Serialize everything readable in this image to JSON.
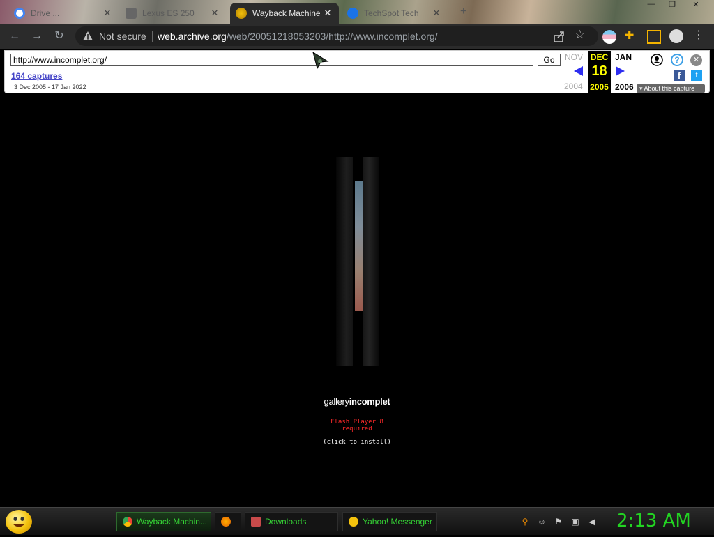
{
  "tabs": [
    {
      "title": "Drive ...",
      "favicon": "google-icon"
    },
    {
      "title": "Lexus ES 250",
      "favicon": "car-icon"
    },
    {
      "title": "Wayback Machine",
      "favicon": "wayback-icon",
      "active": true
    },
    {
      "title": "TechSpot Tech",
      "favicon": "techspot-icon"
    }
  ],
  "omnibox": {
    "security_label": "Not secure",
    "url_domain": "web.archive.org",
    "url_path": "/web/20051218053203/http://www.incomplet.org/"
  },
  "wayback": {
    "url_value": "http://www.incomplet.org/",
    "go_label": "Go",
    "captures_label": "164 captures",
    "range_label": "3 Dec 2005 - 17 Jan 2022",
    "prev_month": "NOV",
    "prev_year": "2004",
    "cur_month": "DEC",
    "cur_day": "18",
    "cur_year": "2005",
    "next_month": "JAN",
    "next_year": "2006",
    "about_label": "About this capture"
  },
  "page": {
    "logo_light": "gallery",
    "logo_bold": "incomplet",
    "flash_line1": "Flash Player 8",
    "flash_line2": "required",
    "install_text": "(click to install)"
  },
  "taskbar": {
    "items": [
      {
        "label": "Wayback Machin...",
        "icon": "chrome-icon"
      },
      {
        "label": "",
        "icon": "firefox-icon"
      },
      {
        "label": "Downloads",
        "icon": "downloads-icon"
      },
      {
        "label": "Yahoo! Messenger",
        "icon": "yahoo-messenger-icon"
      }
    ],
    "clock": "2:13 AM"
  },
  "colors": {
    "accent_green": "#22d322",
    "wayback_yellow": "#ffff00",
    "captures_link": "#4646c8",
    "flash_red": "#ff2a2a"
  }
}
